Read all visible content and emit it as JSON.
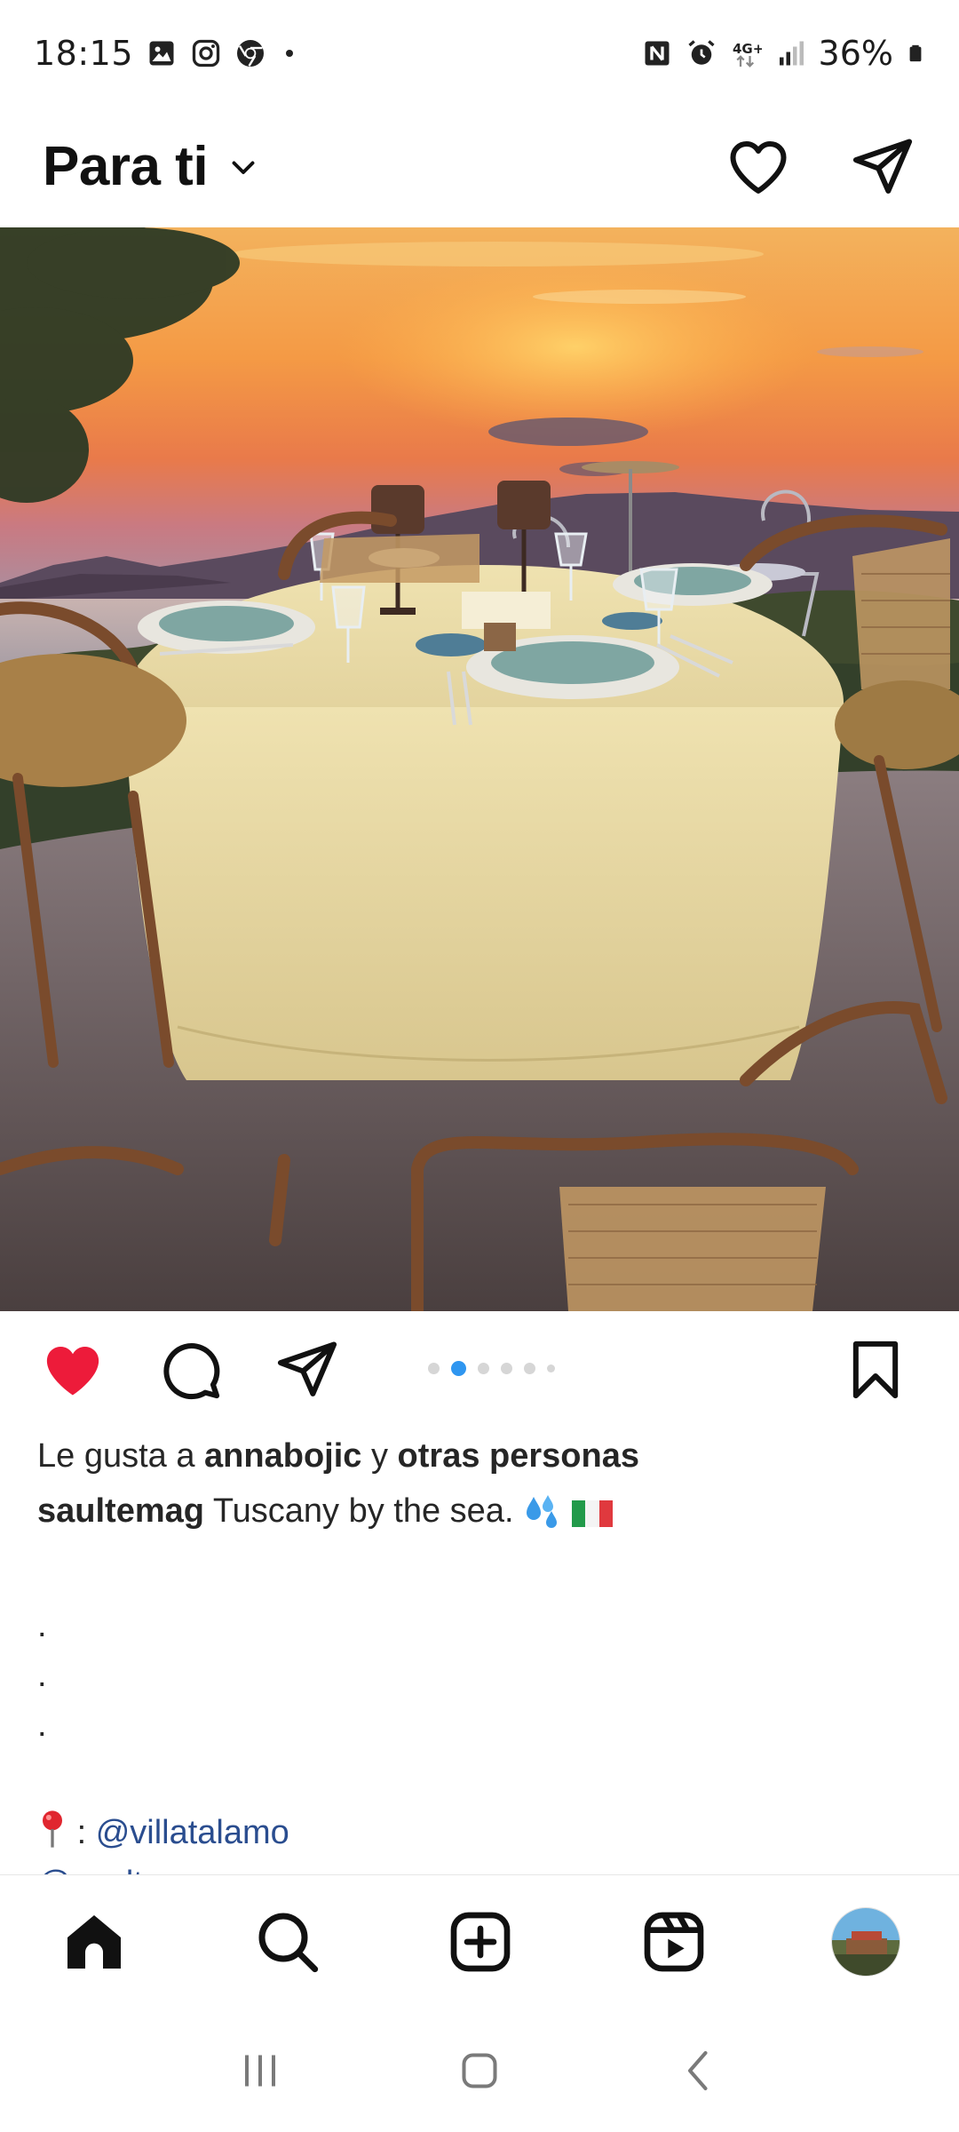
{
  "status_bar": {
    "time": "18:15",
    "battery": "36%",
    "left_icons": [
      "gallery-icon",
      "instagram-icon",
      "chrome-icon",
      "dot-icon"
    ],
    "right_icons": [
      "nfc-icon",
      "alarm-icon",
      "4g-icon",
      "signal-icon",
      "battery-icon"
    ]
  },
  "header": {
    "title": "Para ti",
    "dropdown_icon": "chevron-down-icon",
    "actions": [
      "heart-icon",
      "direct-message-icon"
    ]
  },
  "post": {
    "image_description_icon": "post-photo",
    "carousel": {
      "total": 6,
      "active_index": 1
    },
    "liked": true,
    "colors": {
      "like": "#ed1b3a",
      "dot_active": "#2f96f0",
      "dot_inactive": "#d6d6d6",
      "link": "#2a4d8f"
    },
    "likes_prefix": "Le gusta a",
    "likes_user": "annabojic",
    "likes_joiner": "y",
    "likes_others": "otras personas",
    "caption_user": "saultemag",
    "caption_text": "Tuscany by the sea.",
    "caption_dots": [
      ".",
      ".",
      "."
    ],
    "location_sep": ":",
    "location_link": "@villatalamo",
    "mention_link": "@saultemag"
  },
  "bottom_nav": [
    "home-icon",
    "search-icon",
    "create-icon",
    "reels-icon",
    "profile-avatar"
  ],
  "android_nav": [
    "recents-icon",
    "home-button-icon",
    "back-icon"
  ]
}
